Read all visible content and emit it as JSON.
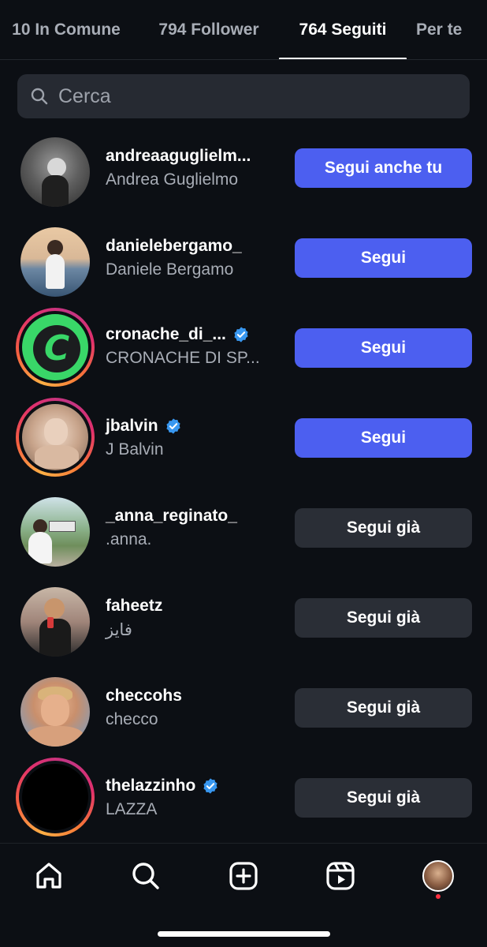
{
  "tabs": [
    {
      "label": "10 In Comune",
      "active": false
    },
    {
      "label": "794 Follower",
      "active": false
    },
    {
      "label": "764 Seguiti",
      "active": true
    },
    {
      "label": "Per te",
      "active": false
    }
  ],
  "search": {
    "placeholder": "Cerca",
    "value": ""
  },
  "accounts": [
    {
      "username": "andreaaguglielm...",
      "full_name": "Andrea Guglielmo",
      "verified": false,
      "story_ring": false,
      "button": "Segui anche tu",
      "button_style": "primary"
    },
    {
      "username": "danielebergamo_",
      "full_name": "Daniele Bergamo",
      "verified": false,
      "story_ring": false,
      "button": "Segui",
      "button_style": "primary"
    },
    {
      "username": "cronache_di_...",
      "full_name": "CRONACHE DI SP...",
      "verified": true,
      "story_ring": true,
      "button": "Segui",
      "button_style": "primary"
    },
    {
      "username": "jbalvin",
      "full_name": "J Balvin",
      "verified": true,
      "story_ring": true,
      "button": "Segui",
      "button_style": "primary"
    },
    {
      "username": "_anna_reginato_",
      "full_name": ".anna.",
      "verified": false,
      "story_ring": false,
      "button": "Segui già",
      "button_style": "secondary"
    },
    {
      "username": "faheetz",
      "full_name": "فايز",
      "verified": false,
      "story_ring": false,
      "button": "Segui già",
      "button_style": "secondary"
    },
    {
      "username": "checcohs",
      "full_name": "checco",
      "verified": false,
      "story_ring": false,
      "button": "Segui già",
      "button_style": "secondary"
    },
    {
      "username": "thelazzinho",
      "full_name": "LAZZA",
      "verified": true,
      "story_ring": true,
      "button": "Segui già",
      "button_style": "secondary"
    }
  ],
  "bottom_nav": {
    "items": [
      "home-icon",
      "search-icon",
      "create-icon",
      "reels-icon",
      "profile-avatar"
    ],
    "profile_notification": true
  },
  "colors": {
    "background": "#0c0f14",
    "primary_button": "#4c5ff0",
    "secondary_button": "#2a2e36",
    "verified_badge": "#3897f0",
    "notification_dot": "#ff3040"
  }
}
